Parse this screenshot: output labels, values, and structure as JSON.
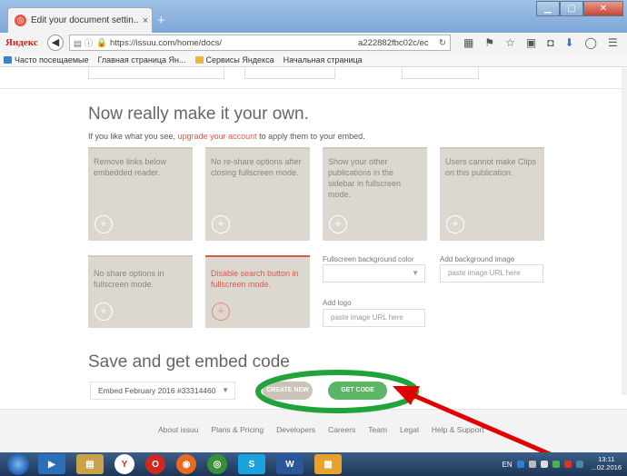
{
  "browser": {
    "tab_title": "Edit your document settin...",
    "tab_close": "×",
    "new_tab": "+",
    "brand": "Яндекс",
    "url_host": "https://issuu.com/home/docs/",
    "url_tail": "a222882fbc02c/ec",
    "bookmarks": [
      {
        "label": "Часто посещаемые",
        "icon": "page"
      },
      {
        "label": "Главная страница Ян...",
        "icon": "page"
      },
      {
        "label": "Сервисы Яндекса",
        "icon": "folder"
      },
      {
        "label": "Начальная страница",
        "icon": "page"
      }
    ]
  },
  "page": {
    "heading": "Now really make it your own.",
    "subline_pre": "If you like what you see, ",
    "subline_link": "upgrade your account",
    "subline_post": " to apply them to your embed.",
    "cards": [
      {
        "text": "Remove links below embedded reader.",
        "icon": "+"
      },
      {
        "text": "No re-share options after closing fullscreen mode.",
        "icon": "+"
      },
      {
        "text": "Show your other publications in the sidebar in fullscreen mode.",
        "icon": "+"
      },
      {
        "text": "Users cannot make Clips on this publication.",
        "icon": "+"
      },
      {
        "text": "No share options in fullscreen mode.",
        "icon": "+"
      },
      {
        "text": "Disable search button in fullscreen mode.",
        "icon": "+"
      }
    ],
    "fullscreen_bg_label": "Fullscreen background color",
    "add_bg_image_label": "Add background image",
    "bg_image_placeholder": "paste image URL here",
    "add_logo_label": "Add logo",
    "logo_placeholder": "paste image URL here",
    "save_heading": "Save and get embed code",
    "embed_select_value": "Embed February 2016 #33314460",
    "create_new_label": "CREATE NEW",
    "get_code_label": "GET CODE",
    "footer_links": [
      "About issuu",
      "Plans & Pricing",
      "Developers",
      "Careers",
      "Team",
      "Legal",
      "Help & Support"
    ]
  },
  "taskbar": {
    "language": "EN",
    "time": "13:11",
    "date": "...02.2016"
  },
  "colors": {
    "accent_red": "#e2574c",
    "green_button": "#5bb565",
    "card_bg": "#ddd8cf",
    "annotation_red": "#e00000",
    "annotation_green": "#1fa33a"
  }
}
